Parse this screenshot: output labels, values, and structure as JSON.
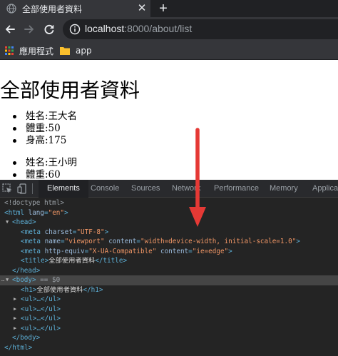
{
  "browser": {
    "tab": {
      "title": "全部使用者資料",
      "close_icon": "close-icon"
    },
    "new_tab_icon": "plus-icon",
    "url_host": "localhost",
    "url_rest": ":8000/about/list",
    "bookmarks": [
      {
        "label": "應用程式",
        "icon": "apps-grid-icon"
      },
      {
        "label": "app",
        "icon": "folder-icon"
      }
    ]
  },
  "page": {
    "heading": "全部使用者資料",
    "users": [
      {
        "name": "姓名:王大名",
        "weight": "體重:50",
        "height": "身高:175"
      },
      {
        "name": "姓名:王小明",
        "weight": "體重:60"
      }
    ]
  },
  "devtools": {
    "tabs": [
      "Elements",
      "Console",
      "Sources",
      "Network",
      "Performance",
      "Memory",
      "Application"
    ],
    "active_tab": "Elements",
    "source": {
      "doctype": "<!doctype html>",
      "html_open": "<html",
      "lang_attr": "lang",
      "lang_val": "\"en\"",
      "head_open": "<head>",
      "meta1_attr": "charset",
      "meta1_val": "\"UTF-8\"",
      "meta2_attr1": "name",
      "meta2_val1": "\"viewport\"",
      "meta2_attr2": "content",
      "meta2_val2": "\"width=device-width, initial-scale=1.0\"",
      "meta3_attr1": "http-equiv",
      "meta3_val1": "\"X-UA-Compatible\"",
      "meta3_attr2": "content",
      "meta3_val2": "\"ie=edge\"",
      "title_text": "全部使用者資料",
      "head_close": "</head>",
      "body_open": "<body>",
      "body_marker": "== $0",
      "h1_text": "全部使用者資料",
      "ul_collapsed": "<ul>…</ul>",
      "body_close": "</body>",
      "html_close": "</html>"
    }
  },
  "colors": {
    "annotation_arrow": "#e53935"
  }
}
